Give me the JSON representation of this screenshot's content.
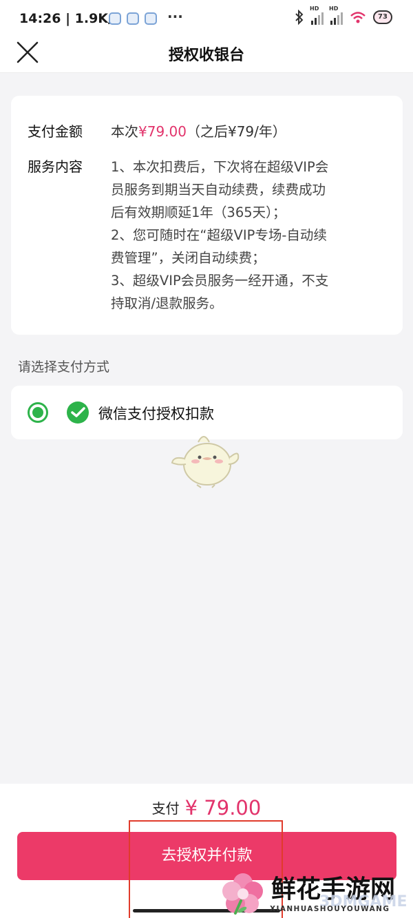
{
  "status_bar": {
    "time": "14:26 | 1.9K/s",
    "more": "···",
    "battery": "73",
    "signal_1_label": "HD",
    "signal_2_label": "HD"
  },
  "header": {
    "title": "授权收银台"
  },
  "info": {
    "amount_label": "支付金额",
    "amount_prefix": "本次",
    "amount_price": "¥79.00",
    "amount_suffix": "（之后¥79/年）",
    "service_label": "服务内容",
    "service_lines": [
      "1、本次扣费后，下次将在超级VIP会",
      "员服务到期当天自动续费，续费成功",
      "后有效期顺延1年（365天）；",
      "2、您可随时在“超级VIP专场-自动续",
      "费管理”，关闭自动续费；",
      "3、超级VIP会员服务一经开通，不支",
      "持取消/退款服务。"
    ]
  },
  "payment": {
    "section_label": "请选择支付方式",
    "method_label": "微信支付授权扣款"
  },
  "footer": {
    "total_label": "支付",
    "total_amount": "¥ 79.00",
    "submit_label": "去授权并付款"
  },
  "watermark": {
    "title": "鲜花手游网",
    "subtitle": "XIANHUASHOUYOUWANG",
    "game": "3DMGAME"
  },
  "colors": {
    "accent": "#ec3a68",
    "price": "#e2336b",
    "wechat_green": "#2db34a",
    "background": "#f4f4f6"
  }
}
